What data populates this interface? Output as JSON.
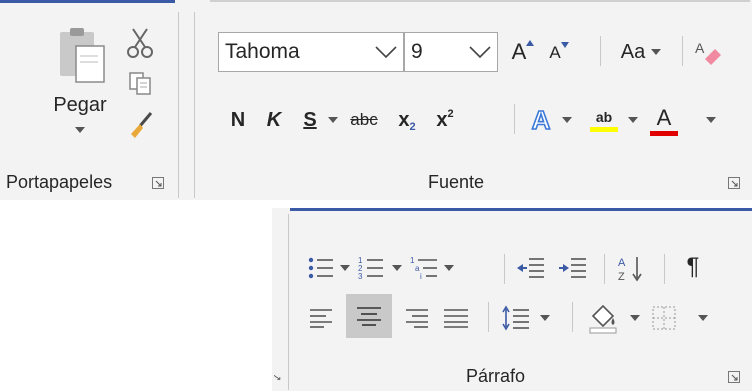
{
  "clipboard": {
    "group_label": "Portapapeles",
    "paste_label": "Pegar"
  },
  "font": {
    "group_label": "Fuente",
    "font_name": "Tahoma",
    "font_size": "9",
    "change_case_label": "Aa",
    "bold_label": "N",
    "italic_label": "K",
    "underline_label": "S",
    "strike_label": "abc",
    "subscript_label": "x",
    "superscript_label": "x",
    "text_effects_label": "A",
    "highlight_label": "ab",
    "font_color_label": "A",
    "grow_label": "A",
    "shrink_label": "A"
  },
  "paragraph": {
    "group_label": "Párrafo",
    "show_marks_label": "¶"
  },
  "colors": {
    "accent": "#3b5aa6",
    "panel": "#f3f3f3",
    "highlight": "#ffff00",
    "font_color": "#e00000",
    "selected": "#c9c9c9"
  }
}
